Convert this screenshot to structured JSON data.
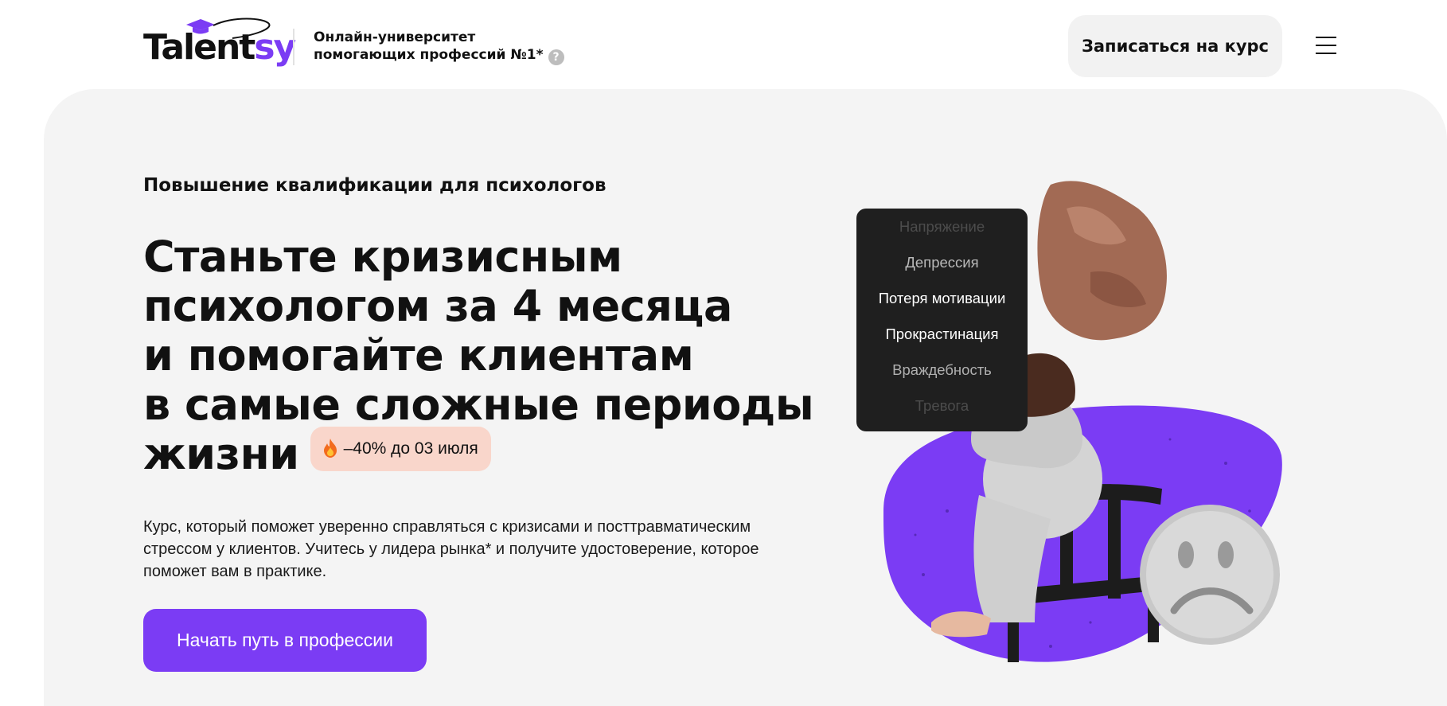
{
  "header": {
    "logo_main": "Talent",
    "logo_accent": "sy",
    "tagline_line1": "Онлайн-университет",
    "tagline_line2": "помогающих профессий №1*",
    "help_icon_glyph": "?",
    "enroll_label": "Записаться на курс"
  },
  "hero": {
    "eyebrow": "Повышение квалификации для психологов",
    "title_lines": [
      "Станьте кризисным",
      "психологом за 4 месяца",
      "и помогайте клиентам",
      "в самые сложные периоды",
      "жизни"
    ],
    "promo": "–40% до 03 июля",
    "description": "Курс, который поможет уверенно справляться с кризисами и посттравматическим стрессом у клиентов. Учитесь у лидера рынка* и получите удостоверение, которое поможет вам в практике.",
    "cta_label": "Начать путь в профессии"
  },
  "illustration": {
    "states": [
      "Напряжение",
      "Депрессия",
      "Потеря мотивации",
      "Прокрастинация",
      "Враждебность",
      "Тревога"
    ]
  },
  "colors": {
    "accent": "#7b3cf4",
    "hero_bg": "#f4f4f4",
    "promo_bg": "#f9d6cb",
    "list_bg": "#1f1f1f"
  },
  "icons": [
    "graduation-cap-icon",
    "help-icon",
    "menu-icon",
    "fire-icon",
    "sad-face-icon"
  ]
}
